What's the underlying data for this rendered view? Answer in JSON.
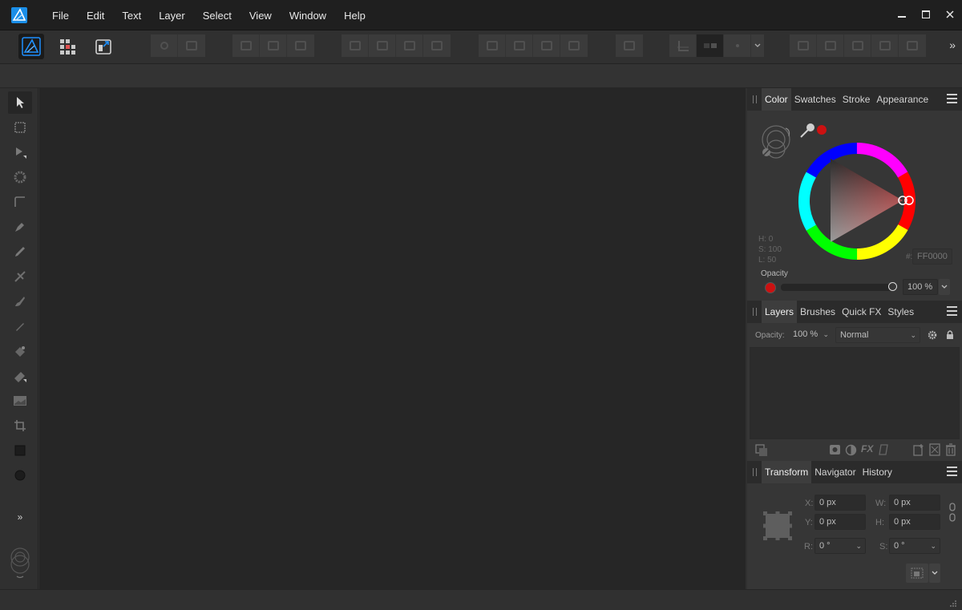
{
  "menu": {
    "items": [
      "File",
      "Edit",
      "Text",
      "Layer",
      "Select",
      "View",
      "Window",
      "Help"
    ]
  },
  "window_controls": {
    "minimize": "—",
    "maximize": "☐",
    "close": "✕"
  },
  "toolbar": {
    "more": "»"
  },
  "tools": {
    "more": "»"
  },
  "color_panel": {
    "tabs": [
      "Color",
      "Swatches",
      "Stroke",
      "Appearance"
    ],
    "active_tab": "Color",
    "hsl": {
      "h": "H: 0",
      "s": "S: 100",
      "l": "L: 50"
    },
    "hex_label": "#:",
    "hex_value": "FF0000",
    "opacity_label": "Opacity",
    "opacity_value": "100 %",
    "opacity_fraction": 1.0,
    "current_color": "#cc1111"
  },
  "layers_panel": {
    "tabs": [
      "Layers",
      "Brushes",
      "Quick FX",
      "Styles"
    ],
    "active_tab": "Layers",
    "opacity_label": "Opacity:",
    "opacity_value": "100 %",
    "blend_mode": "Normal"
  },
  "transform_panel": {
    "tabs": [
      "Transform",
      "Navigator",
      "History"
    ],
    "active_tab": "Transform",
    "x_label": "X:",
    "x_value": "0 px",
    "y_label": "Y:",
    "y_value": "0 px",
    "w_label": "W:",
    "w_value": "0 px",
    "h_label": "H:",
    "h_value": "0 px",
    "r_label": "R:",
    "r_value": "0 °",
    "s_label": "S:",
    "s_value": "0 °"
  },
  "colors": {
    "accent": "#1e90ff",
    "canvas": "#262626",
    "panel": "#363636"
  }
}
